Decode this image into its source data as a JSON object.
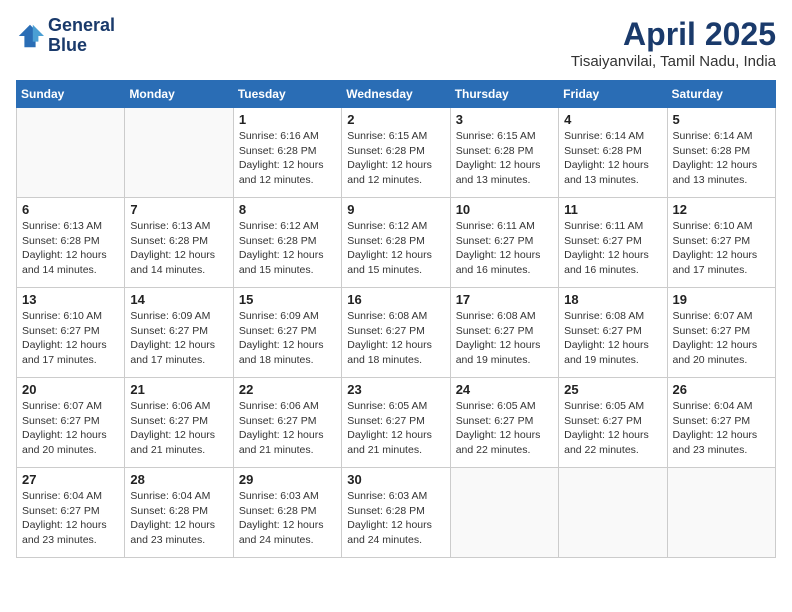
{
  "header": {
    "logo_line1": "General",
    "logo_line2": "Blue",
    "month": "April 2025",
    "location": "Tisaiyanvilai, Tamil Nadu, India"
  },
  "weekdays": [
    "Sunday",
    "Monday",
    "Tuesday",
    "Wednesday",
    "Thursday",
    "Friday",
    "Saturday"
  ],
  "weeks": [
    [
      {
        "day": "",
        "info": ""
      },
      {
        "day": "",
        "info": ""
      },
      {
        "day": "1",
        "info": "Sunrise: 6:16 AM\nSunset: 6:28 PM\nDaylight: 12 hours and 12 minutes."
      },
      {
        "day": "2",
        "info": "Sunrise: 6:15 AM\nSunset: 6:28 PM\nDaylight: 12 hours and 12 minutes."
      },
      {
        "day": "3",
        "info": "Sunrise: 6:15 AM\nSunset: 6:28 PM\nDaylight: 12 hours and 13 minutes."
      },
      {
        "day": "4",
        "info": "Sunrise: 6:14 AM\nSunset: 6:28 PM\nDaylight: 12 hours and 13 minutes."
      },
      {
        "day": "5",
        "info": "Sunrise: 6:14 AM\nSunset: 6:28 PM\nDaylight: 12 hours and 13 minutes."
      }
    ],
    [
      {
        "day": "6",
        "info": "Sunrise: 6:13 AM\nSunset: 6:28 PM\nDaylight: 12 hours and 14 minutes."
      },
      {
        "day": "7",
        "info": "Sunrise: 6:13 AM\nSunset: 6:28 PM\nDaylight: 12 hours and 14 minutes."
      },
      {
        "day": "8",
        "info": "Sunrise: 6:12 AM\nSunset: 6:28 PM\nDaylight: 12 hours and 15 minutes."
      },
      {
        "day": "9",
        "info": "Sunrise: 6:12 AM\nSunset: 6:28 PM\nDaylight: 12 hours and 15 minutes."
      },
      {
        "day": "10",
        "info": "Sunrise: 6:11 AM\nSunset: 6:27 PM\nDaylight: 12 hours and 16 minutes."
      },
      {
        "day": "11",
        "info": "Sunrise: 6:11 AM\nSunset: 6:27 PM\nDaylight: 12 hours and 16 minutes."
      },
      {
        "day": "12",
        "info": "Sunrise: 6:10 AM\nSunset: 6:27 PM\nDaylight: 12 hours and 17 minutes."
      }
    ],
    [
      {
        "day": "13",
        "info": "Sunrise: 6:10 AM\nSunset: 6:27 PM\nDaylight: 12 hours and 17 minutes."
      },
      {
        "day": "14",
        "info": "Sunrise: 6:09 AM\nSunset: 6:27 PM\nDaylight: 12 hours and 17 minutes."
      },
      {
        "day": "15",
        "info": "Sunrise: 6:09 AM\nSunset: 6:27 PM\nDaylight: 12 hours and 18 minutes."
      },
      {
        "day": "16",
        "info": "Sunrise: 6:08 AM\nSunset: 6:27 PM\nDaylight: 12 hours and 18 minutes."
      },
      {
        "day": "17",
        "info": "Sunrise: 6:08 AM\nSunset: 6:27 PM\nDaylight: 12 hours and 19 minutes."
      },
      {
        "day": "18",
        "info": "Sunrise: 6:08 AM\nSunset: 6:27 PM\nDaylight: 12 hours and 19 minutes."
      },
      {
        "day": "19",
        "info": "Sunrise: 6:07 AM\nSunset: 6:27 PM\nDaylight: 12 hours and 20 minutes."
      }
    ],
    [
      {
        "day": "20",
        "info": "Sunrise: 6:07 AM\nSunset: 6:27 PM\nDaylight: 12 hours and 20 minutes."
      },
      {
        "day": "21",
        "info": "Sunrise: 6:06 AM\nSunset: 6:27 PM\nDaylight: 12 hours and 21 minutes."
      },
      {
        "day": "22",
        "info": "Sunrise: 6:06 AM\nSunset: 6:27 PM\nDaylight: 12 hours and 21 minutes."
      },
      {
        "day": "23",
        "info": "Sunrise: 6:05 AM\nSunset: 6:27 PM\nDaylight: 12 hours and 21 minutes."
      },
      {
        "day": "24",
        "info": "Sunrise: 6:05 AM\nSunset: 6:27 PM\nDaylight: 12 hours and 22 minutes."
      },
      {
        "day": "25",
        "info": "Sunrise: 6:05 AM\nSunset: 6:27 PM\nDaylight: 12 hours and 22 minutes."
      },
      {
        "day": "26",
        "info": "Sunrise: 6:04 AM\nSunset: 6:27 PM\nDaylight: 12 hours and 23 minutes."
      }
    ],
    [
      {
        "day": "27",
        "info": "Sunrise: 6:04 AM\nSunset: 6:27 PM\nDaylight: 12 hours and 23 minutes."
      },
      {
        "day": "28",
        "info": "Sunrise: 6:04 AM\nSunset: 6:28 PM\nDaylight: 12 hours and 23 minutes."
      },
      {
        "day": "29",
        "info": "Sunrise: 6:03 AM\nSunset: 6:28 PM\nDaylight: 12 hours and 24 minutes."
      },
      {
        "day": "30",
        "info": "Sunrise: 6:03 AM\nSunset: 6:28 PM\nDaylight: 12 hours and 24 minutes."
      },
      {
        "day": "",
        "info": ""
      },
      {
        "day": "",
        "info": ""
      },
      {
        "day": "",
        "info": ""
      }
    ]
  ]
}
